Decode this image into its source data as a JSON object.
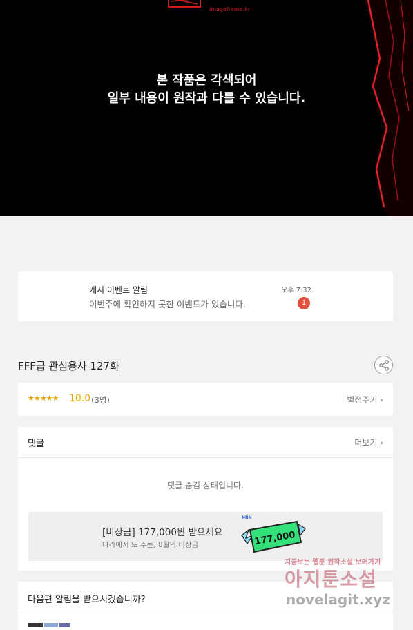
{
  "hero": {
    "brand": "imageframe.kr",
    "notice_line1": "본 작품은 각색되어",
    "notice_line2": "일부 내용이 원작과 다를 수 있습니다."
  },
  "alert": {
    "title": "캐시 이벤트 알림",
    "text": "이번주에 확인하지 못한 이벤트가 있습니다.",
    "time": "오후 7:32",
    "badge": "1"
  },
  "episode": {
    "title": "FFF급 관심용사 127화"
  },
  "rating": {
    "stars": "★★★★★",
    "score": "10.0",
    "count": "(3명)",
    "rate_label": "별점주기 ›"
  },
  "comments": {
    "title": "댓글",
    "more_label": "더보기 ›",
    "hidden_message": "댓글 숨김 상태입니다.",
    "banner_title": "[비상금] 177,000원 받으세요",
    "banner_sub": "나라에서 또 주는, 8월의 비상금",
    "banner_amount": "177,000",
    "banner_tag": "NRN"
  },
  "notify": {
    "title": "다음편 알림을 받으시겠습니까?"
  },
  "watermark": {
    "top": "지금보는 웹툰 원작소설 보러가기",
    "mid": "아지툰소설",
    "bottom": "novelagit.xyz"
  },
  "colors": {
    "accent_red": "#d11b24",
    "badge_red": "#e0503c",
    "star_yellow": "#e8a400",
    "bill_green": "#34e07a"
  }
}
